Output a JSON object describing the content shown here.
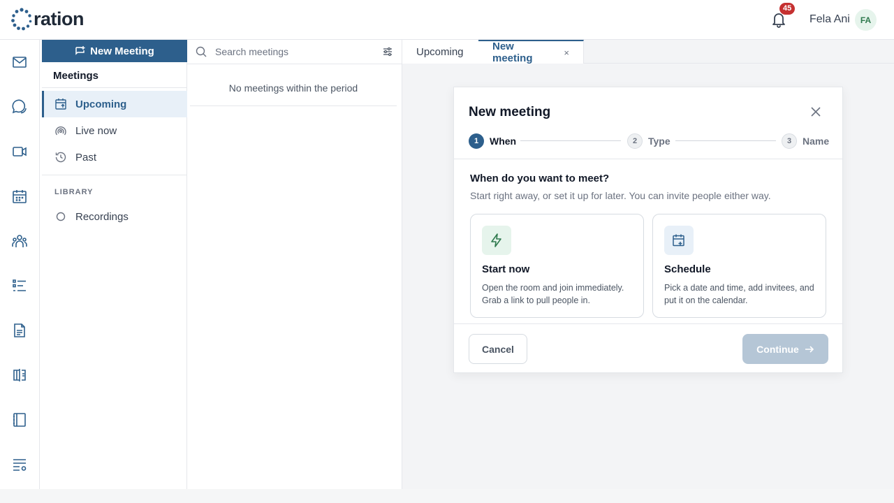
{
  "app": {
    "logo_text": "ration"
  },
  "header": {
    "notification_count": "45",
    "user_name": "Fela Ani",
    "user_initials": "FA"
  },
  "rail": {
    "icons": [
      "mail-icon",
      "chat-icon",
      "video-icon",
      "calendar-icon",
      "people-icon",
      "tasks-icon",
      "document-icon",
      "book-icon",
      "notebook-icon",
      "settings-list-icon"
    ]
  },
  "sidebar": {
    "new_button": "New Meeting",
    "title": "Meetings",
    "items": [
      {
        "label": "Upcoming",
        "icon": "calendar-arrow-icon",
        "active": true
      },
      {
        "label": "Live now",
        "icon": "broadcast-icon",
        "active": false
      },
      {
        "label": "Past",
        "icon": "history-icon",
        "active": false
      }
    ],
    "section_label": "LIBRARY",
    "library_items": [
      {
        "label": "Recordings",
        "icon": "circle-icon"
      }
    ]
  },
  "list": {
    "search_placeholder": "Search meetings",
    "empty_message": "No meetings within the period"
  },
  "tabs": [
    {
      "label": "Upcoming",
      "active": false
    },
    {
      "label": "New meeting",
      "active": true,
      "close": "×"
    }
  ],
  "dialog": {
    "title": "New meeting",
    "steps": [
      {
        "num": "1",
        "label": "When"
      },
      {
        "num": "2",
        "label": "Type"
      },
      {
        "num": "3",
        "label": "Name"
      }
    ],
    "question": "When do you want to meet?",
    "subtitle": "Start right away, or set it up for later. You can invite people either way.",
    "options": [
      {
        "title": "Start now",
        "desc": "Open the room and join immediately. Grab a link to pull people in.",
        "icon": "lightning-icon"
      },
      {
        "title": "Schedule",
        "desc": "Pick a date and time, add invitees, and put it on the calendar.",
        "icon": "calendar-plus-icon"
      }
    ],
    "cancel": "Cancel",
    "continue": "Continue"
  },
  "colors": {
    "primary": "#2d5f8c",
    "badge": "#c53030",
    "continue_disabled": "#b5c6d6"
  }
}
